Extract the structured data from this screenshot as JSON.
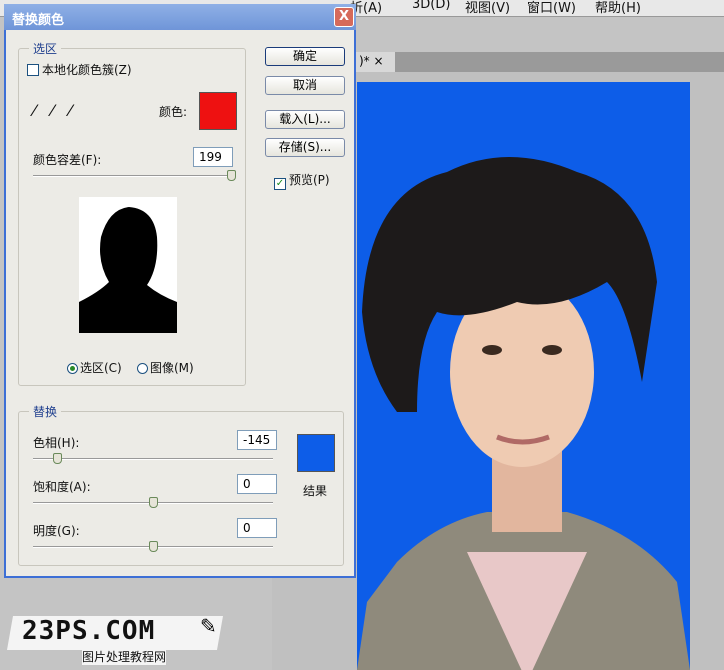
{
  "menu": [
    "析(A)",
    "3D(D)",
    "视图(V)",
    "窗口(W)",
    "帮助(H)"
  ],
  "tab": {
    "label": ")* ×"
  },
  "dialog": {
    "title": "替换颜色",
    "close": "X",
    "selection": {
      "group_label": "选区",
      "localized_label": "本地化颜色簇(Z)",
      "color_label": "颜色:",
      "color": "#ee1111",
      "fuzziness_label": "颜色容差(F):",
      "fuzziness": "199",
      "fuzziness_pct": 100,
      "radio_selection": "选区(C)",
      "radio_image": "图像(M)"
    },
    "buttons": {
      "ok": "确定",
      "cancel": "取消",
      "load": "载入(L)...",
      "save": "存储(S)..."
    },
    "preview_label": "预览(P)",
    "replace": {
      "group_label": "替换",
      "hue_label": "色相(H):",
      "hue": "-145",
      "hue_pct": 10,
      "sat_label": "饱和度(A):",
      "sat": "0",
      "sat_pct": 50,
      "light_label": "明度(G):",
      "light": "0",
      "light_pct": 50,
      "result_label": "结果",
      "result_color": "#0d5de8"
    }
  },
  "watermark": {
    "logo": "23PS.COM",
    "sub": "图片处理教程网"
  }
}
